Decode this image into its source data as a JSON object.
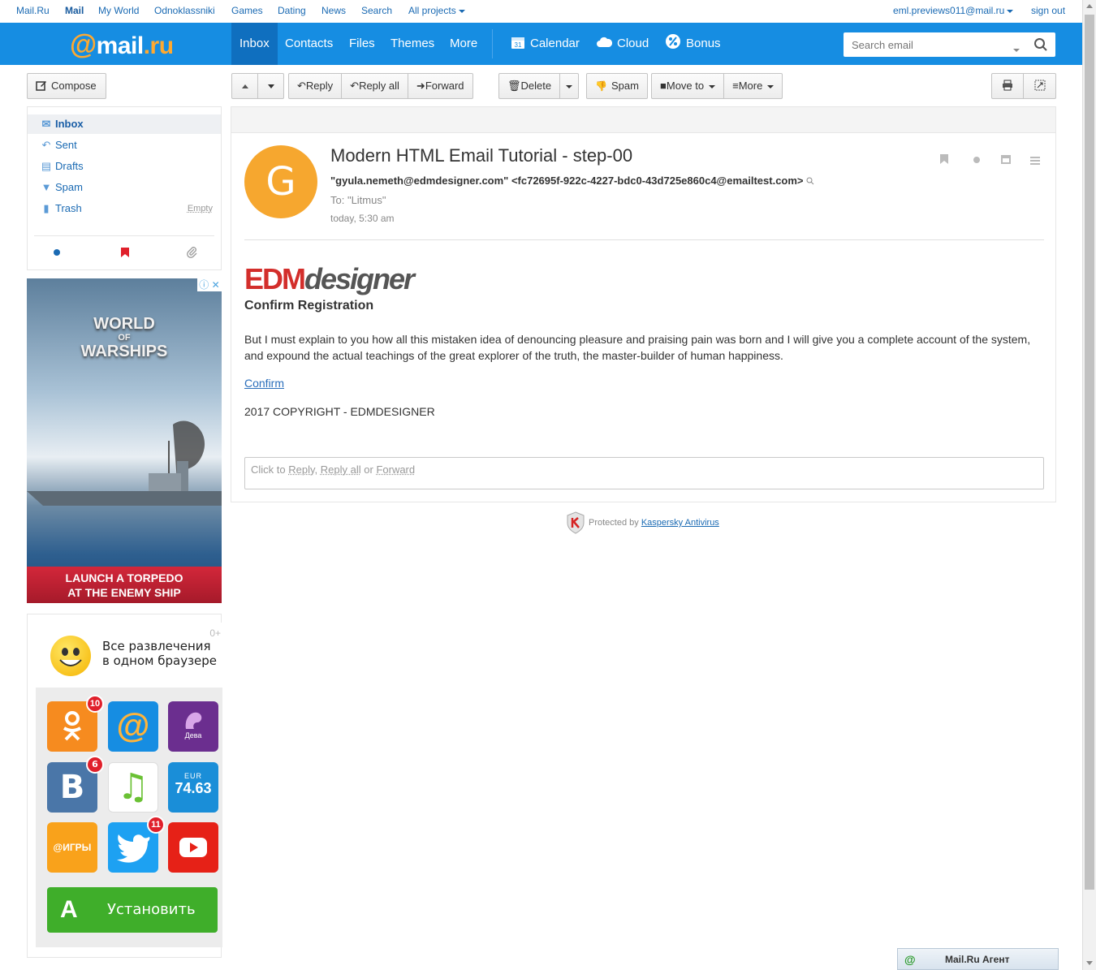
{
  "portal": {
    "links": [
      "Mail.Ru",
      "Mail",
      "My World",
      "Odnoklassniki",
      "Games",
      "Dating",
      "News",
      "Search",
      "All projects"
    ],
    "user_email": "eml.previews011@mail.ru",
    "sign_out": "sign out"
  },
  "header": {
    "logo_at": "@",
    "logo_mail": "mail",
    "logo_ru": ".ru",
    "nav": [
      "Inbox",
      "Contacts",
      "Files",
      "Themes",
      "More"
    ],
    "services": [
      "Calendar",
      "Cloud",
      "Bonus"
    ],
    "calendar_day": "31",
    "search_placeholder": "Search email"
  },
  "toolbar": {
    "compose": "Compose",
    "reply": "Reply",
    "reply_all": "Reply all",
    "forward": "Forward",
    "delete": "Delete",
    "spam": "Spam",
    "move_to": "Move to",
    "more": "More"
  },
  "folders": [
    {
      "label": "Inbox",
      "icon": "envelope-icon",
      "active": true
    },
    {
      "label": "Sent",
      "icon": "reply-arrow-icon"
    },
    {
      "label": "Drafts",
      "icon": "draft-icon"
    },
    {
      "label": "Spam",
      "icon": "thumbs-down-icon"
    },
    {
      "label": "Trash",
      "icon": "trash-icon",
      "action": "Empty"
    }
  ],
  "filters": [
    "unread-dot-icon",
    "flag-icon",
    "attachment-icon"
  ],
  "ad1": {
    "brand_line1": "WORLD",
    "brand_line2": "OF",
    "brand_line3": "WARSHIPS",
    "cta_line1": "LAUNCH A TORPEDO",
    "cta_line2": "AT THE ENEMY SHIP"
  },
  "ad2": {
    "age": "0+",
    "tagline_line1": "Все развлечения",
    "tagline_line2": "в одном браузере",
    "tiles": [
      {
        "label": "ok",
        "badge": "10",
        "color": "#f68b1f"
      },
      {
        "label": "@",
        "color": "#168de2"
      },
      {
        "label": "Дева",
        "color": "#6b2e8f"
      },
      {
        "label": "B",
        "badge": "6",
        "color": "#4a76a8"
      },
      {
        "label": "♫",
        "color": "#ffffff"
      },
      {
        "label_top": "EUR",
        "label": "74.63",
        "color": "#1a8ed8"
      },
      {
        "label": "@ИГРЫ",
        "color": "#f9a21b"
      },
      {
        "label": "twitter",
        "badge": "11",
        "color": "#1da1f2"
      },
      {
        "label": "youtube",
        "color": "#e62117"
      }
    ],
    "install": "Установить",
    "install_logo": "A"
  },
  "message": {
    "avatar_letter": "G",
    "subject": "Modern HTML Email Tutorial - step-00",
    "from": "\"gyula.nemeth@edmdesigner.com\" <fc72695f-922c-4227-bdc0-43d725e860c4@emailtest.com>",
    "to": "To: \"Litmus\"",
    "date": "today, 5:30 am",
    "logo_edm": "EDM",
    "logo_designer": "designer",
    "heading": "Confirm Registration",
    "body": "But I must explain to you how all this mistaken idea of denouncing pleasure and praising pain was born and I will give you a complete account of the system, and expound the actual teachings of the great explorer of the truth, the master-builder of human happiness.",
    "link": "Confirm",
    "copyright": "2017 COPYRIGHT - EDMDESIGNER",
    "quick_reply_prefix": "Click to",
    "quick_reply_reply": "Reply",
    "quick_reply_reply_all": "Reply all",
    "quick_reply_or": "or",
    "quick_reply_forward": "Forward"
  },
  "footer": {
    "protected_by": "Protected by",
    "kaspersky": "Kaspersky Antivirus",
    "agent": "Mail.Ru Агент"
  },
  "colors": {
    "header_blue": "#168de2",
    "header_active": "#0f6fbf",
    "link": "#1a6ab3",
    "avatar": "#f6a72f",
    "edm_red": "#d32e2b"
  }
}
